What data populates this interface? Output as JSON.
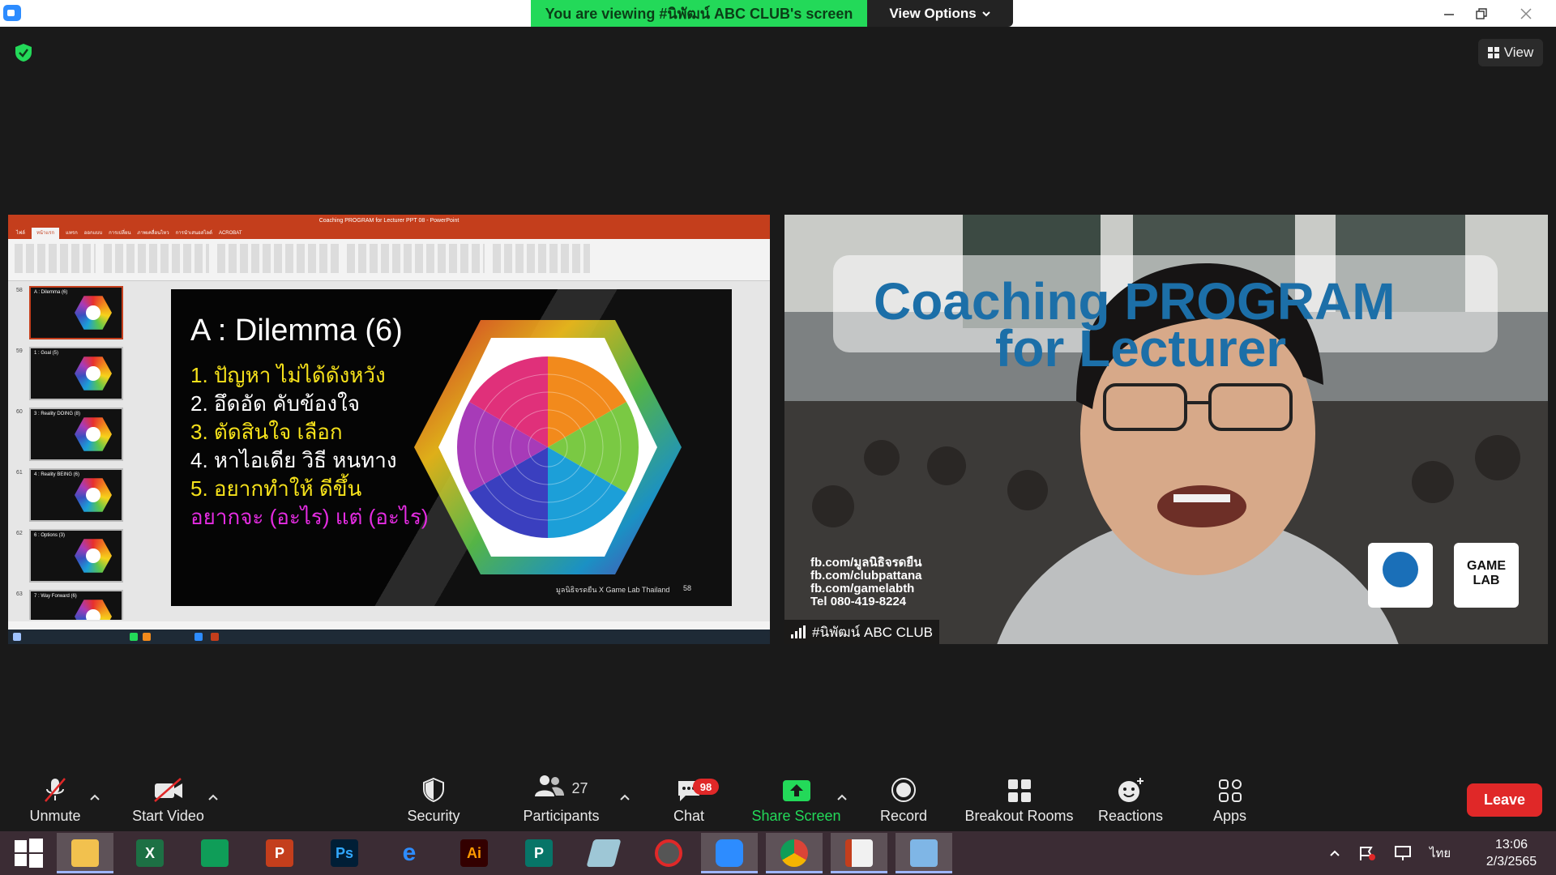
{
  "window": {
    "banner_text": "You are viewing #นิพัฒน์ ABC CLUB's screen",
    "view_options_label": "View Options",
    "view_button_label": "View"
  },
  "slide": {
    "title": "A : Dilemma (6)",
    "lines": [
      {
        "text": "1.  ปัญหา ไม่ได้ดังหวัง",
        "color": "#f6e21b"
      },
      {
        "text": "2. อึดอัด คับข้องใจ",
        "color": "#ffffff"
      },
      {
        "text": "3. ตัดสินใจ เลือก",
        "color": "#f6e21b"
      },
      {
        "text": "4. หาไอเดีย วิธี หนทาง",
        "color": "#ffffff"
      },
      {
        "text": "5. อยากทำให้ ดีขึ้น",
        "color": "#f6e21b"
      },
      {
        "text": "อยากจะ (อะไร) แต่ (อะไร)",
        "color": "#e52ce2"
      }
    ],
    "footer": "มูลนิธิจรดยืน X Game Lab Thailand",
    "number": "58"
  },
  "thumbnails": [
    {
      "num": "58",
      "title": "A : Dilemma (6)",
      "selected": true
    },
    {
      "num": "59",
      "title": "1 : Goal (5)",
      "selected": false
    },
    {
      "num": "60",
      "title": "3 : Reality DOING (8)",
      "selected": false
    },
    {
      "num": "61",
      "title": "4 : Reality BEING (6)",
      "selected": false
    },
    {
      "num": "62",
      "title": "6 : Options (3)",
      "selected": false
    },
    {
      "num": "63",
      "title": "7 : Way Forward (6)",
      "selected": false
    }
  ],
  "video": {
    "participant_name": "#นิพัฒน์ ABC CLUB",
    "background_title_line1": "Coaching PROGRAM",
    "background_title_line2": "for Lecturer",
    "contact_lines": [
      "fb.com/มูลนิธิจรดยืน",
      "fb.com/clubpattana",
      "fb.com/gamelabth",
      "Tel 080-419-8224"
    ],
    "logo_text_line1": "GAME",
    "logo_text_line2": "LAB"
  },
  "toolbar": {
    "unmute": "Unmute",
    "start_video": "Start Video",
    "security": "Security",
    "participants": "Participants",
    "participants_count": "27",
    "chat": "Chat",
    "chat_badge": "98",
    "share_screen": "Share Screen",
    "record": "Record",
    "breakout_rooms": "Breakout Rooms",
    "reactions": "Reactions",
    "apps": "Apps",
    "leave": "Leave"
  },
  "taskbar": {
    "language": "ไทย",
    "time": "13:06",
    "date": "2/3/2565"
  },
  "colors": {
    "banner_green": "#23d959",
    "leave_red": "#e02828",
    "ppt_orange": "#c43e1c"
  }
}
